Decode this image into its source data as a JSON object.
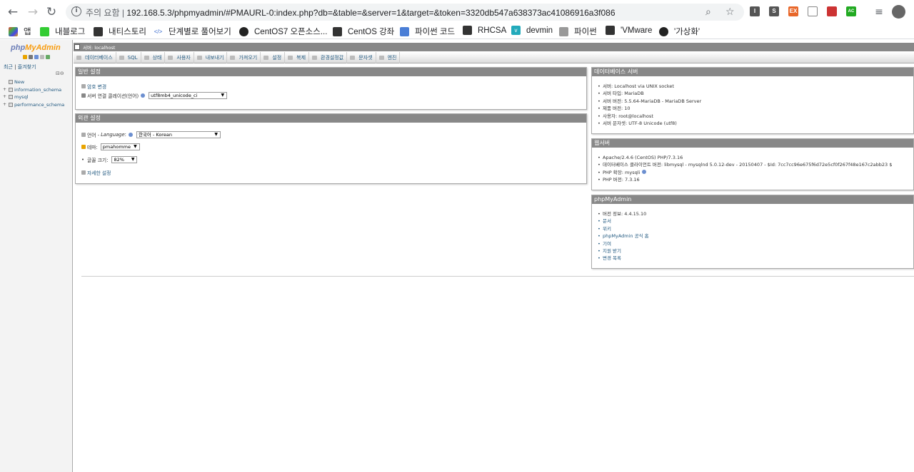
{
  "browser": {
    "warning": "주의 요함",
    "url": "192.168.5.3/phpmyadmin/#PMAURL-0:index.php?db=&table=&server=1&target=&token=3320db547a638373ac41086916a3f086",
    "extensions": [
      "I",
      "S",
      "EX",
      "",
      "",
      "AC"
    ],
    "bookmarks": [
      "앱",
      "내블로그",
      "내티스토리",
      "단계별로 풀어보기",
      "CentOS7 오픈소스...",
      "CentOS 강좌",
      "파이썬 코드",
      "RHCSA",
      "devmin",
      "파이썬",
      "'VMware",
      "'가상화'"
    ]
  },
  "sidebar": {
    "logo_php": "php",
    "logo_my": "MyAdmin",
    "recent": "최근",
    "favorites": "즐겨찾기",
    "tree": [
      "New",
      "information_schema",
      "mysql",
      "performance_schema"
    ]
  },
  "topbar": {
    "breadcrumb": "서버: localhost"
  },
  "menu": [
    "데이터베이스",
    "SQL",
    "상태",
    "사용자",
    "내보내기",
    "가져오기",
    "설정",
    "복제",
    "환경설정값",
    "문자셋",
    "엔진"
  ],
  "general": {
    "title": "일반 설정",
    "change_password": "암호 변경",
    "collation_label": "서버 연결 콜레이션(언어)",
    "collation_value": "utf8mb4_unicode_ci"
  },
  "appearance": {
    "title": "외관 설정",
    "language_label": "언어 - ",
    "language_label_en": "Language",
    "language_value": "한국어 - Korean",
    "theme_label": "테마:",
    "theme_value": "pmahomme",
    "fontsize_label": "글꼴 크기:",
    "fontsize_value": "82%",
    "more_settings": "자세한 설정"
  },
  "db_server": {
    "title": "데이터베이스 서버",
    "items": [
      "서버: Localhost via UNIX socket",
      "서버 타입: MariaDB",
      "서버 버전: 5.5.64-MariaDB - MariaDB Server",
      "제품 버전: 10",
      "사용자: root@localhost",
      "서버 문자셋: UTF-8 Unicode (utf8)"
    ]
  },
  "web_server": {
    "title": "웹서버",
    "items": [
      "Apache/2.4.6 (CentOS) PHP/7.3.16",
      "데이터베이스 클라이언트 버전: libmysql - mysqlnd 5.0.12-dev - 20150407 - $Id: 7cc7cc96e675f6d72e5cf0f267f48e167c2abb23 $",
      "PHP 확장: mysqli",
      "PHP 버전: 7.3.16"
    ]
  },
  "pma_info": {
    "title": "phpMyAdmin",
    "version": "버전 정보: 4.4.15.10",
    "links": [
      "문서",
      "위키",
      "phpMyAdmin 공식 홈",
      "기여",
      "지원 받기",
      "변경 목록"
    ]
  }
}
